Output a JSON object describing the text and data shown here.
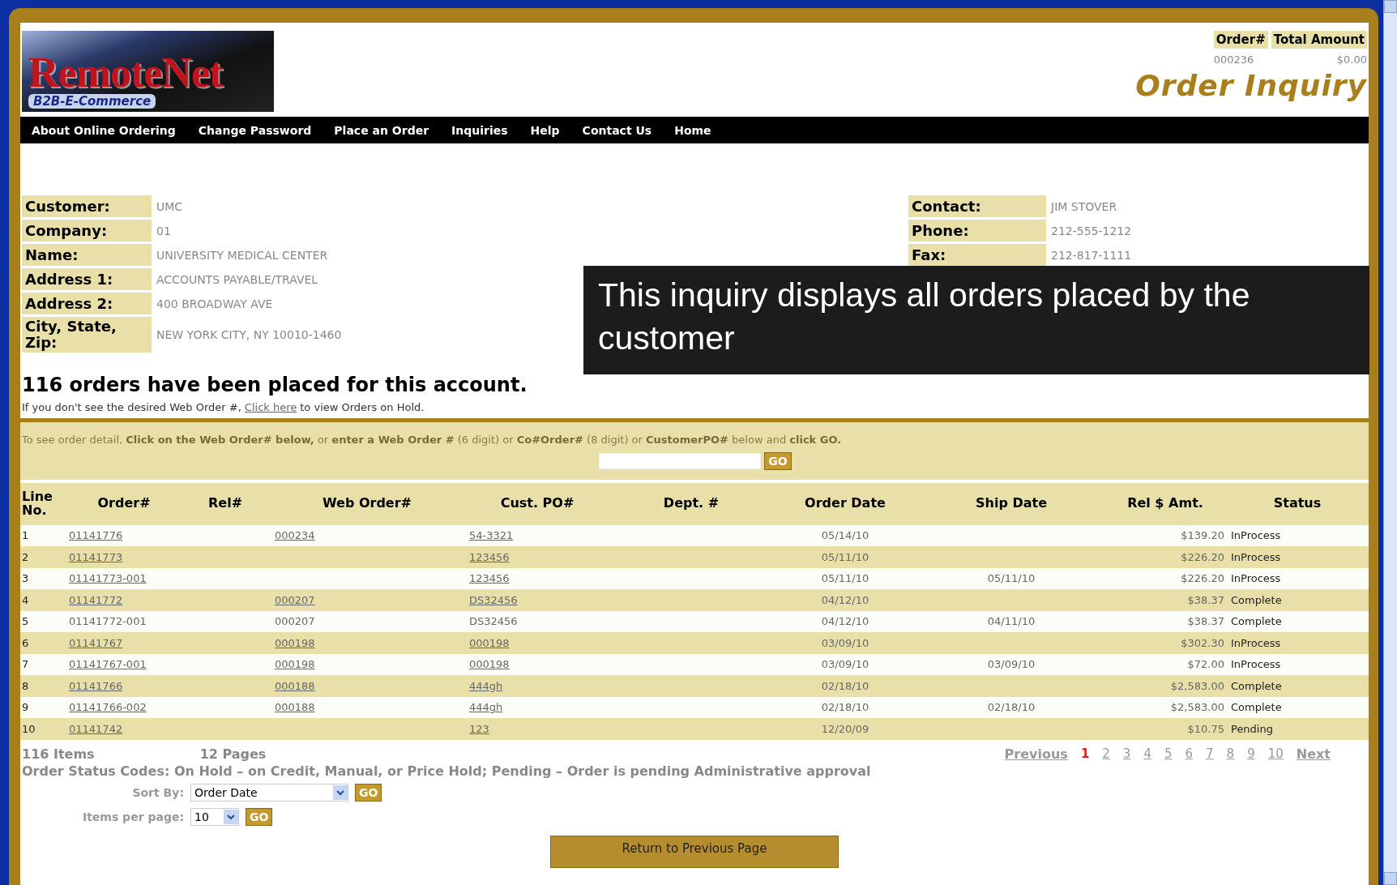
{
  "header": {
    "logo_text": "RemoteNet",
    "logo_tagline": "B2B-E-Commerce",
    "order_summary": {
      "columns": [
        "Order#",
        "Total Amount"
      ],
      "values": [
        "000236",
        "$0.00"
      ]
    },
    "page_title": "Order Inquiry"
  },
  "nav": [
    "About Online Ordering",
    "Change Password",
    "Place an Order",
    "Inquiries",
    "Help",
    "Contact Us",
    "Home"
  ],
  "customer": [
    {
      "label": "Customer:",
      "value": "UMC"
    },
    {
      "label": "Company:",
      "value": "01"
    },
    {
      "label": "Name:",
      "value": "UNIVERSITY MEDICAL CENTER"
    },
    {
      "label": "Address 1:",
      "value": "ACCOUNTS PAYABLE/TRAVEL"
    },
    {
      "label": "Address 2:",
      "value": "400 BROADWAY AVE"
    },
    {
      "label": "City, State, Zip:",
      "value": "NEW YORK CITY, NY 10010-1460"
    }
  ],
  "contact": [
    {
      "label": "Contact:",
      "value": "JIM STOVER"
    },
    {
      "label": "Phone:",
      "value": "212-555-1212"
    },
    {
      "label": "Fax:",
      "value": "212-817-1111"
    }
  ],
  "caption": "This inquiry displays all orders placed by the customer",
  "summary": "116 orders have been placed for this account.",
  "hold_note": {
    "before": "If you don't see the desired Web Order #,",
    "link": "Click here",
    "after": "to view Orders on Hold."
  },
  "search": {
    "instruction": "To see order detail, **Click on the Web Order# below,** or **enter a Web Order #** (6 digit) or **Co#Order#** (8 digit) or **CustomerPO#** below and **click GO.**",
    "button": "GO"
  },
  "table": {
    "columns": [
      "Line No.",
      "Order#",
      "Rel#",
      "Web Order#",
      "Cust. PO#",
      "Dept. #",
      "Order Date",
      "Ship Date",
      "Rel $ Amt.",
      "Status"
    ],
    "rows": [
      {
        "line": "1",
        "order": "01141776",
        "web": "000234",
        "po": "54-3321",
        "order_date": "05/14/10",
        "ship_date": "",
        "amount": "$139.20",
        "status": "InProcess",
        "linked": true
      },
      {
        "line": "2",
        "order": "01141773",
        "web": "",
        "po": "123456",
        "order_date": "05/11/10",
        "ship_date": "",
        "amount": "$226.20",
        "status": "InProcess",
        "linked": true
      },
      {
        "line": "3",
        "order": "01141773-001",
        "web": "",
        "po": "123456",
        "order_date": "05/11/10",
        "ship_date": "05/11/10",
        "amount": "$226.20",
        "status": "InProcess",
        "linked": true
      },
      {
        "line": "4",
        "order": "01141772",
        "web": "000207",
        "po": "DS32456",
        "order_date": "04/12/10",
        "ship_date": "",
        "amount": "$38.37",
        "status": "Complete",
        "linked": true
      },
      {
        "line": "5",
        "order": "01141772-001",
        "web": "000207",
        "po": "DS32456",
        "order_date": "04/12/10",
        "ship_date": "04/11/10",
        "amount": "$38.37",
        "status": "Complete",
        "linked": false
      },
      {
        "line": "6",
        "order": "01141767",
        "web": "000198",
        "po": "000198",
        "order_date": "03/09/10",
        "ship_date": "",
        "amount": "$302.30",
        "status": "InProcess",
        "linked": true
      },
      {
        "line": "7",
        "order": "01141767-001",
        "web": "000198",
        "po": "000198",
        "order_date": "03/09/10",
        "ship_date": "03/09/10",
        "amount": "$72.00",
        "status": "InProcess",
        "linked": true
      },
      {
        "line": "8",
        "order": "01141766",
        "web": "000188",
        "po": "444gh",
        "order_date": "02/18/10",
        "ship_date": "",
        "amount": "$2,583.00",
        "status": "Complete",
        "linked": true
      },
      {
        "line": "9",
        "order": "01141766-002",
        "web": "000188",
        "po": "444gh",
        "order_date": "02/18/10",
        "ship_date": "02/18/10",
        "amount": "$2,583.00",
        "status": "Complete",
        "linked": true
      },
      {
        "line": "10",
        "order": "01141742",
        "web": "",
        "po": "123",
        "order_date": "12/20/09",
        "ship_date": "",
        "amount": "$10.75",
        "status": "Pending",
        "linked": true
      }
    ]
  },
  "footer": {
    "items": "116 Items",
    "pages_count": "12 Pages",
    "previous": "Previous",
    "pages": [
      {
        "label": "1",
        "selected": true
      },
      {
        "label": "2",
        "selected": false
      },
      {
        "label": "3",
        "selected": false
      },
      {
        "label": "4",
        "selected": false
      },
      {
        "label": "5",
        "selected": false
      },
      {
        "label": "6",
        "selected": false
      },
      {
        "label": "7",
        "selected": false
      },
      {
        "label": "8",
        "selected": false
      },
      {
        "label": "9",
        "selected": false
      },
      {
        "label": "10",
        "selected": false
      }
    ],
    "next": "Next",
    "status_codes": "Order Status Codes: On Hold – on Credit, Manual, or Price Hold; Pending – Order is pending Administrative approval",
    "sort_label": "Sort By:",
    "sort_value": "Order Date",
    "sort_button": "GO",
    "per_page_label": "Items per page:",
    "per_page_value": "10",
    "per_page_button": "GO",
    "return_button": "Return to Previous Page"
  }
}
